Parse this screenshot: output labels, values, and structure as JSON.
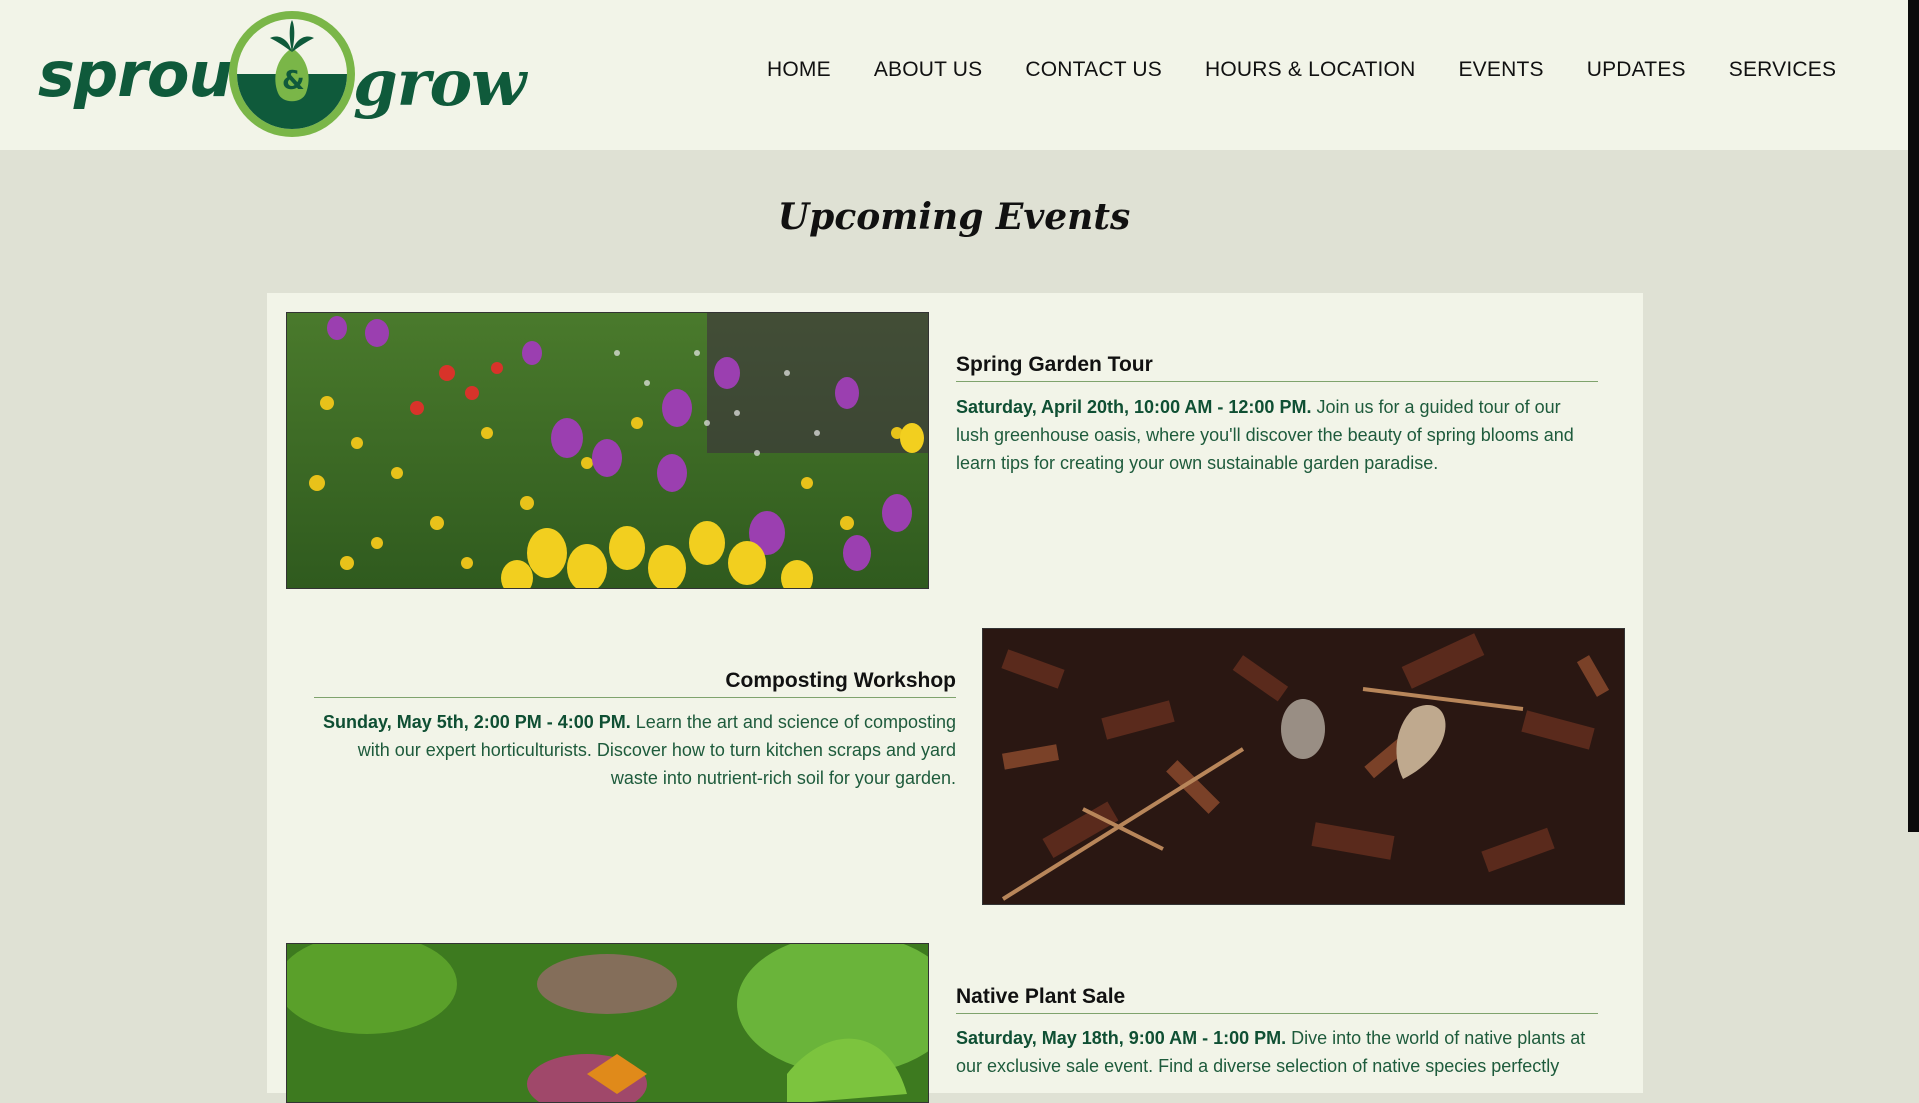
{
  "brand": {
    "word_left": "sprout",
    "ampersand": "&",
    "word_right": "grow",
    "colors": {
      "dark_green": "#0f5a3b",
      "light_green": "#7ab648",
      "cream": "#f2f4e8"
    }
  },
  "nav": {
    "items": [
      {
        "label": "HOME"
      },
      {
        "label": "ABOUT US"
      },
      {
        "label": "CONTACT US"
      },
      {
        "label": "HOURS & LOCATION"
      },
      {
        "label": "EVENTS"
      },
      {
        "label": "UPDATES"
      },
      {
        "label": "SERVICES"
      }
    ]
  },
  "page": {
    "title": "Upcoming Events"
  },
  "events": [
    {
      "title": "Spring Garden Tour",
      "when": "Saturday, April 20th, 10:00 AM - 12:00 PM.",
      "description": "Join us for a guided tour of our lush greenhouse oasis, where you'll discover the beauty of spring blooms and learn tips for creating your own sustainable garden paradise.",
      "image": "tulip-garden-photo"
    },
    {
      "title": "Composting Workshop",
      "when": "Sunday, May 5th, 2:00 PM - 4:00 PM.",
      "description": "Learn the art and science of composting with our expert horticulturists. Discover how to turn kitchen scraps and yard waste into nutrient-rich soil for your garden.",
      "image": "compost-photo"
    },
    {
      "title": "Native Plant Sale",
      "when": "Saturday, May 18th, 9:00 AM - 1:00 PM.",
      "description": "Dive into the world of native plants at our exclusive sale event. Find a diverse selection of native species perfectly",
      "image": "butterfly-photo"
    }
  ]
}
